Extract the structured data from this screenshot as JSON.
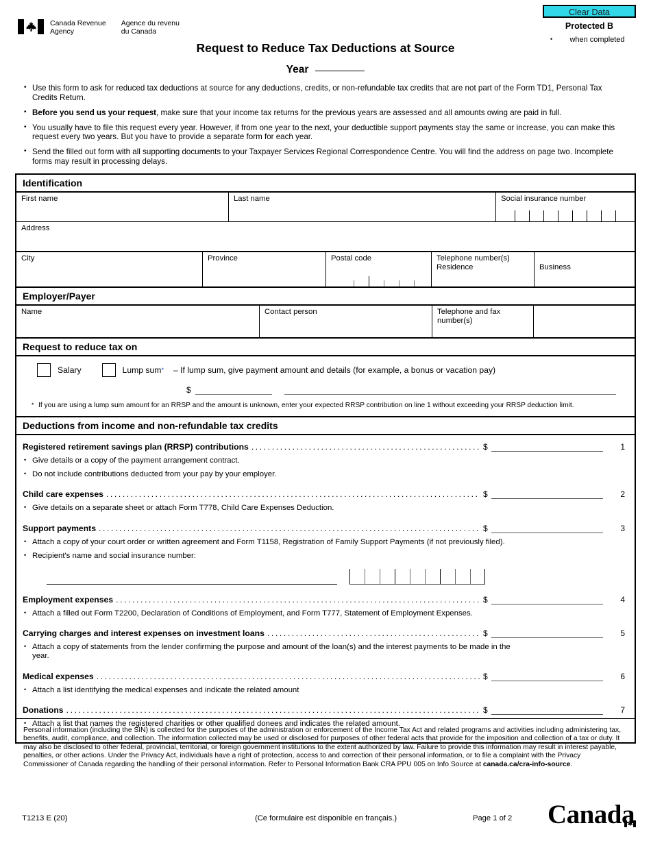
{
  "header": {
    "clear_data_label": "Clear Data",
    "protected_label": "Protected B",
    "protected_sub": "when completed",
    "agency_en": "Canada Revenue\nAgency",
    "agency_fr": "Agence du revenu\ndu Canada",
    "title": "Request to Reduce Tax Deductions at Source",
    "year_label": "Year",
    "accent_color": "#31d8e8"
  },
  "intro": [
    "Use this form to ask for reduced tax deductions at source for any deductions, credits, or non-refundable tax credits that are not part of the Form TD1, Personal Tax Credits Return.",
    "Before you send us your request, make sure that your income tax returns for the previous years are assessed and all amounts owing are paid in full.",
    "You usually have to file this request every year. However, if from one year to the next, your deductible support payments stay the same or increase, you can make this request every two years. But you have to provide a separate form for each year.",
    "Send the filled out form with all supporting documents to your Taxpayer Services Regional Correspondence Centre. You will find the address on page two. Incomplete forms may result in processing delays."
  ],
  "intro_bold_lead": "Before you send us your request",
  "identification": {
    "band": "Identification",
    "first_name": "First name",
    "last_name": "Last name",
    "sin": "Social insurance number",
    "address": "Address",
    "city": "City",
    "province": "Province",
    "postal_code": "Postal code",
    "telephone_numbers": "Telephone number(s)",
    "residence": "Residence",
    "business": "Business"
  },
  "employer": {
    "band": "Employer/Payer",
    "name": "Name",
    "contact_person": "Contact person",
    "telephone_fax": "Telephone and fax number(s)"
  },
  "reduce": {
    "band": "Request to reduce tax on",
    "salary": "Salary",
    "lump_sum": "Lump sum",
    "lump_star": "*",
    "lump_note": "– If lump sum, give payment amount and details (for example, a bonus or vacation pay)",
    "dollar": "$",
    "footnote": "If you are using a lump sum amount for an RRSP and the amount is unknown, enter your expected RRSP contribution on line 1 without exceeding your RRSP deduction limit.",
    "star_color": "#0b4bd4"
  },
  "deductions": {
    "band": "Deductions from income and non-refundable tax credits",
    "dollar": "$",
    "recipient_label": "Recipient's name and social insurance number:",
    "items": [
      {
        "label": "Registered retirement savings plan (RRSP) contributions",
        "line": "1",
        "notes": [
          "Give details or a copy of the payment arrangement contract.",
          "Do not include contributions deducted from your pay by your employer."
        ]
      },
      {
        "label": "Child care expenses",
        "line": "2",
        "notes": [
          "Give details on a separate sheet or attach Form T778, Child Care Expenses Deduction."
        ]
      },
      {
        "label": "Support payments",
        "line": "3",
        "notes": [
          "Attach a copy of your court order or written agreement and Form T1158, Registration of Family Support Payments (if not previously filed).",
          "Recipient's name and social insurance number:"
        ]
      },
      {
        "label": "Employment expenses",
        "line": "4",
        "notes": [
          "Attach a filled out Form T2200, Declaration of Conditions of Employment, and Form T777, Statement of Employment Expenses."
        ]
      },
      {
        "label": "Carrying charges and interest expenses on investment loans",
        "line": "5",
        "notes": [
          "Attach a copy of statements from the lender confirming the purpose and amount of the loan(s) and the interest payments to be made in the year."
        ]
      },
      {
        "label": "Medical expenses",
        "line": "6",
        "notes": [
          "Attach a list identifying the medical expenses and indicate the related amount"
        ]
      },
      {
        "label": "Donations",
        "line": "7",
        "notes": [
          "Attach a list that names the registered charities or other qualified donees and indicates the related amount."
        ]
      }
    ]
  },
  "privacy": {
    "text": "Personal information (including the SIN) is collected for the purposes of the administration or enforcement of the Income Tax Act and related programs and activities including administering tax, benefits, audit, compliance, and collection. The information collected may be used or disclosed for purposes of other federal acts that provide for the imposition and collection of a tax or duty. It may also be disclosed to other federal, provincial, territorial, or foreign government institutions to the extent authorized by law. Failure to provide this information may result in interest payable, penalties, or other actions. Under the Privacy Act, individuals have a right of protection, access to and correction of their personal information, or to file a complaint with the Privacy Commissioner of Canada regarding the handling of their personal information. Refer to Personal Information Bank CRA PPU 005 on Info Source at ",
    "link": "canada.ca/cra-info-source",
    "period": "."
  },
  "footer": {
    "form_code": "T1213 E (20)",
    "french_note": "(Ce formulaire est disponible en français.)",
    "page": "Page 1 of 2",
    "wordmark": "Canada"
  }
}
